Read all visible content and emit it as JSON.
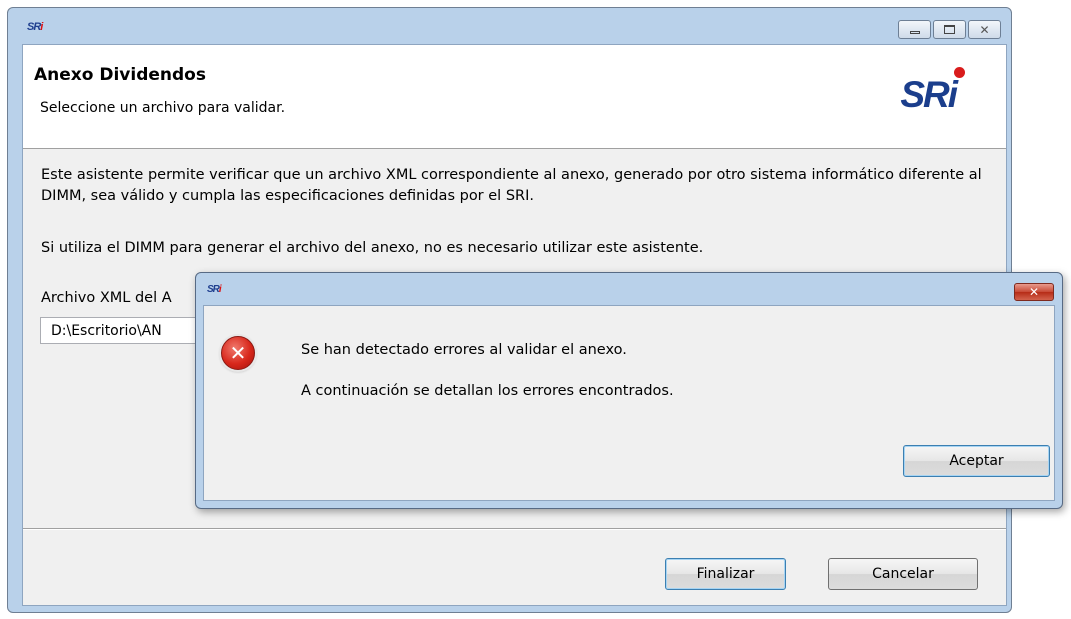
{
  "main_window": {
    "app_icon_label": "SRi",
    "header_title": "Anexo Dividendos",
    "header_subtitle": "Seleccione un archivo para validar.",
    "logo_text": "SRi",
    "description": "Este asistente permite verificar que un archivo XML correspondiente al anexo, generado por otro sistema informático diferente al DIMM, sea válido y cumpla las especificaciones definidas por el SRI.",
    "note": "Si utiliza el DIMM para generar el archivo del anexo, no es necesario utilizar este asistente.",
    "file_label": "Archivo XML del A",
    "file_path": "D:\\Escritorio\\AN",
    "finish_label": "Finalizar",
    "cancel_label": "Cancelar"
  },
  "error_dialog": {
    "app_icon_label": "SRi",
    "message_line1": "Se han detectado errores al validar el anexo.",
    "message_line2": "A continuación se detallan los errores encontrados.",
    "accept_label": "Aceptar",
    "icon": "error-icon"
  },
  "colors": {
    "window_frame": "#b9d1ea",
    "client_bg": "#f0f0f0",
    "logo_blue": "#1b3e8c",
    "logo_red": "#d91c1c",
    "error_red": "#d8281c"
  }
}
